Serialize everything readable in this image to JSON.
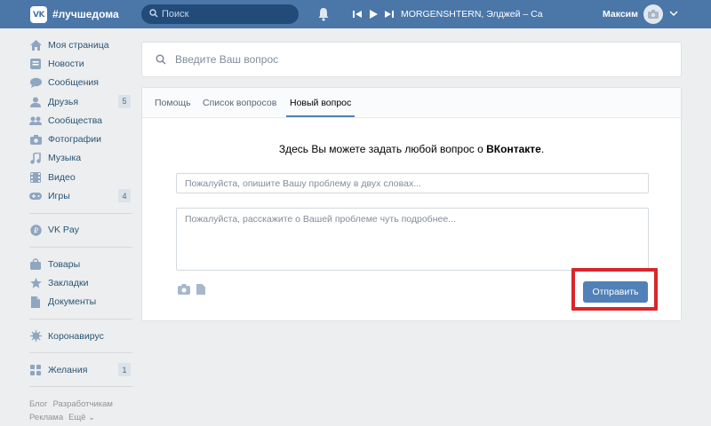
{
  "header": {
    "logo_text": "VK",
    "brand": "#лучшедома",
    "search_placeholder": "Поиск",
    "track": "MORGENSHTERN, Элджей – Cadill...",
    "username": "Максим",
    "bg_color": "#4a76a8"
  },
  "sidebar": {
    "items": [
      {
        "label": "Моя страница",
        "icon": "home-icon"
      },
      {
        "label": "Новости",
        "icon": "news-icon"
      },
      {
        "label": "Сообщения",
        "icon": "messages-icon"
      },
      {
        "label": "Друзья",
        "icon": "friends-icon",
        "badge": "5"
      },
      {
        "label": "Сообщества",
        "icon": "communities-icon"
      },
      {
        "label": "Фотографии",
        "icon": "photos-icon"
      },
      {
        "label": "Музыка",
        "icon": "music-icon"
      },
      {
        "label": "Видео",
        "icon": "video-icon"
      },
      {
        "label": "Игры",
        "icon": "games-icon",
        "badge": "4"
      }
    ],
    "vkpay": "VK Pay",
    "items2": [
      {
        "label": "Товары",
        "icon": "goods-icon"
      },
      {
        "label": "Закладки",
        "icon": "bookmarks-icon"
      },
      {
        "label": "Документы",
        "icon": "documents-icon"
      }
    ],
    "corona": "Коронавирус",
    "wishes": "Желания",
    "wishes_badge": "1",
    "footer": {
      "blog": "Блог",
      "dev": "Разработчикам",
      "ads": "Реклама",
      "more": "Ещё ⌄"
    }
  },
  "main": {
    "question_placeholder": "Введите Ваш вопрос",
    "tabs": [
      "Помощь",
      "Список вопросов",
      "Новый вопрос"
    ],
    "active_tab": "Новый вопрос",
    "intro_prefix": "Здесь Вы можете задать любой вопрос о ",
    "intro_brand": "ВКонтакте",
    "intro_suffix": ".",
    "title_placeholder": "Пожалуйста, опишите Вашу проблему в двух словах...",
    "body_placeholder": "Пожалуйста, расскажите о Вашей проблеме чуть подробнее...",
    "send_label": "Отправить",
    "accent_color": "#5181b8",
    "highlight_color": "#d9262b"
  }
}
